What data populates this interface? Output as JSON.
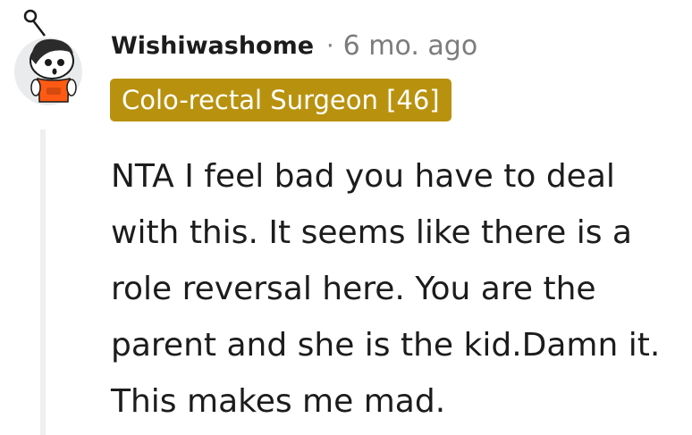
{
  "comment": {
    "avatar_icon": "snoo-avatar-icon",
    "username": "Wishiwashome",
    "separator": "·",
    "timestamp": "6 mo. ago",
    "flair": {
      "text": "Colo-rectal Surgeon [46]",
      "background_color": "#b8920f",
      "text_color": "#ffffff"
    },
    "body": "NTA I feel bad you have to deal with this. It seems like there is a role reversal here. You are the parent and she is the kid.Damn it. This makes me mad."
  }
}
